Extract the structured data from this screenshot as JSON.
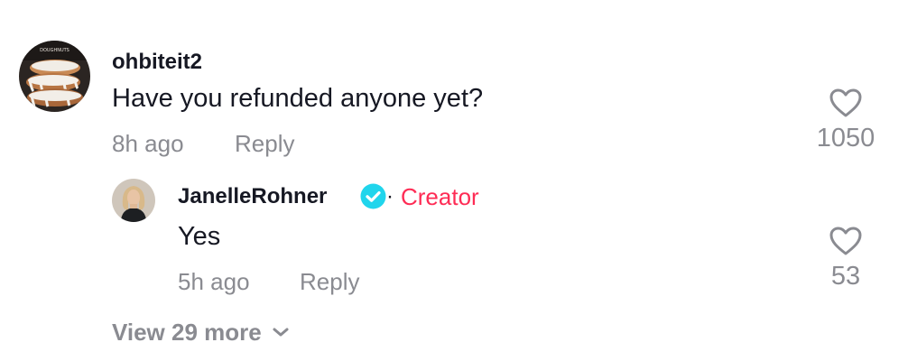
{
  "comment": {
    "username": "ohbiteit2",
    "text": "Have you refunded anyone yet?",
    "time": "8h ago",
    "reply_label": "Reply",
    "like_count": "1050",
    "avatar_text": "DOUGHNUTS"
  },
  "reply": {
    "username": "JanelleRohner",
    "dot": "·",
    "badge": "Creator",
    "text": "Yes",
    "time": "5h ago",
    "reply_label": "Reply",
    "like_count": "53"
  },
  "view_more": {
    "label": "View 29 more"
  },
  "colors": {
    "creator": "#fe2c55",
    "verified": "#20d5ec",
    "meta": "#8a8b91",
    "text": "#161823"
  },
  "icons": {
    "like": "heart-icon",
    "verified": "verified-badge-icon",
    "expand": "chevron-down-icon"
  }
}
